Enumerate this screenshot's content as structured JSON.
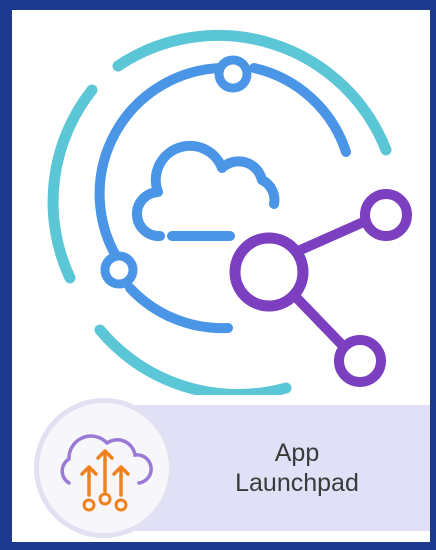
{
  "logo": {
    "icon": "cloud-network-icon",
    "colors": {
      "outer_ring": "#5bc6d6",
      "inner_ring": "#4a95e6",
      "node": "#7b3fc0",
      "background": "#1e3a8f"
    }
  },
  "banner": {
    "title": "App\nLaunchpad",
    "icon": "cloud-upload-arrows-icon",
    "colors": {
      "strip": "#e0e1f6",
      "cloud": "#9b7ad6",
      "arrows": "#f0821e"
    }
  }
}
